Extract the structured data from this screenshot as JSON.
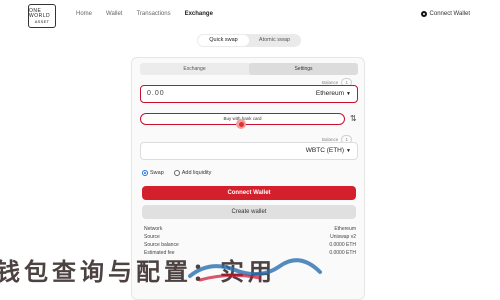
{
  "header": {
    "logo_line1": "ONE WORLD",
    "logo_line2": "ASSET",
    "nav": [
      "Home",
      "Wallet",
      "Transactions",
      "Exchange"
    ],
    "active_nav": "Exchange",
    "connect_label": "Connect Wallet"
  },
  "mode_toggle": {
    "options": [
      "Quick swap",
      "Atomic swap"
    ],
    "active": "Quick swap"
  },
  "tabs": [
    "Exchange",
    "Settings"
  ],
  "from": {
    "balance_label": "Balance",
    "balance_value": "1",
    "amount": "0.00",
    "token": "Ethereum"
  },
  "buy_button_label": "Buy with bank card",
  "swap_direction_icon": "swap-arrows-icon",
  "to": {
    "balance_label": "Balance",
    "balance_value": "1",
    "token": "WBTC (ETH)"
  },
  "mode_radios": [
    {
      "label": "Swap",
      "checked": true
    },
    {
      "label": "Add liquidity",
      "checked": false
    }
  ],
  "buttons": {
    "primary": "Connect Wallet",
    "secondary": "Create wallet"
  },
  "info_rows": [
    {
      "label": "Network",
      "value": "Ethereum"
    },
    {
      "label": "Source",
      "value": "Uniswap v2"
    },
    {
      "label": "Source balance",
      "value": "0.0000 ETH"
    },
    {
      "label": "Estimated fee",
      "value": "0.0000 ETH"
    }
  ],
  "overlay_text": "钱包查询与配置：实用",
  "colors": {
    "accent": "#d41f2c",
    "border_highlight": "#c8102e"
  }
}
